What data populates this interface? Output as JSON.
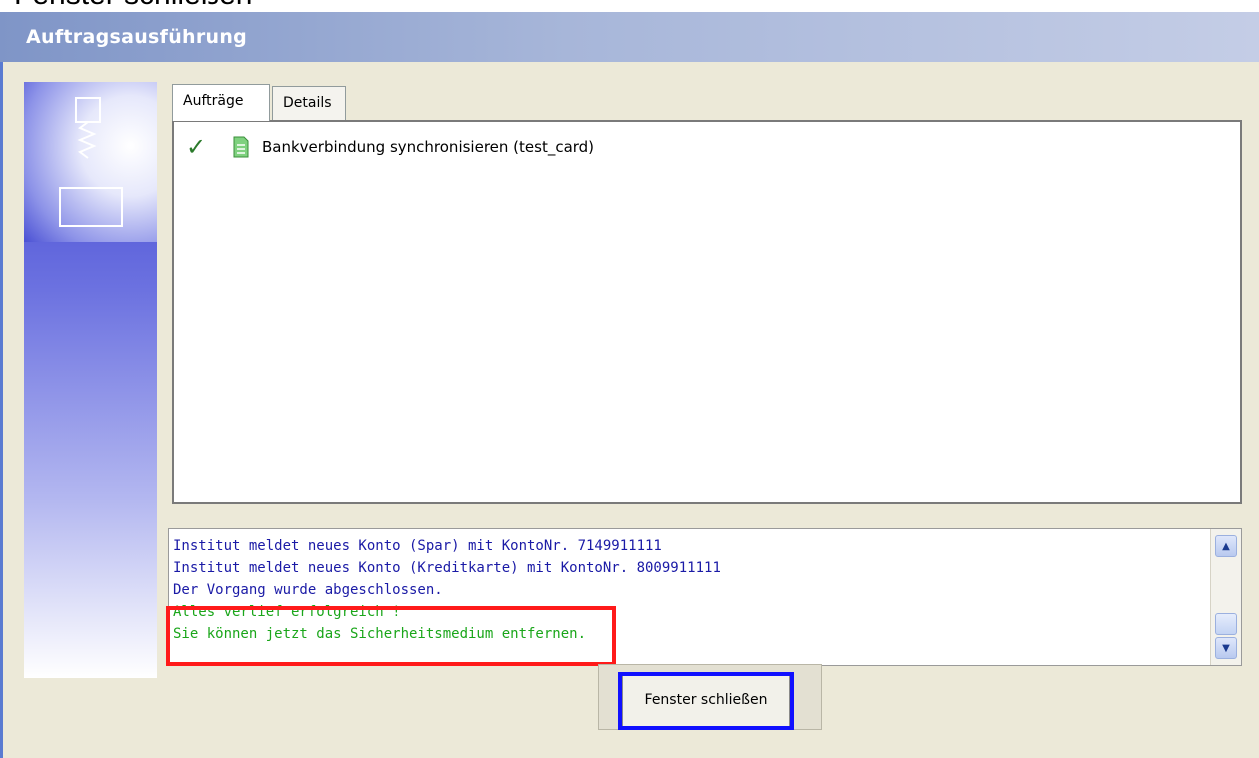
{
  "header_fragment": {
    "text": "Fenster schließen"
  },
  "window": {
    "title": "Auftragsausführung"
  },
  "tabs": [
    {
      "label": "Aufträge"
    },
    {
      "label": "Details"
    }
  ],
  "orders": [
    {
      "status": "✓",
      "label": "Bankverbindung synchronisieren (test_card)"
    }
  ],
  "log": {
    "lines": [
      {
        "text": "Institut meldet neues Konto (Spar) mit KontoNr. 7149911111",
        "color": "#1a1aa6"
      },
      {
        "text": "Institut meldet neues Konto (Kreditkarte) mit KontoNr. 8009911111",
        "color": "#1a1aa6"
      },
      {
        "text": "Der Vorgang wurde abgeschlossen.",
        "color": "#1a1aa6"
      },
      {
        "text": "Alles verlief erfolgreich !",
        "color": "#1aa61a"
      },
      {
        "text": "Sie können jetzt das Sicherheitsmedium entfernen.",
        "color": "#1aa61a"
      }
    ]
  },
  "buttons": {
    "close_label": "Fenster schließen"
  },
  "colors": {
    "highlight_red": "#ff1a1a",
    "highlight_blue": "#1010ff",
    "success_text": "#1aa61a",
    "info_text": "#1a1aa6"
  }
}
